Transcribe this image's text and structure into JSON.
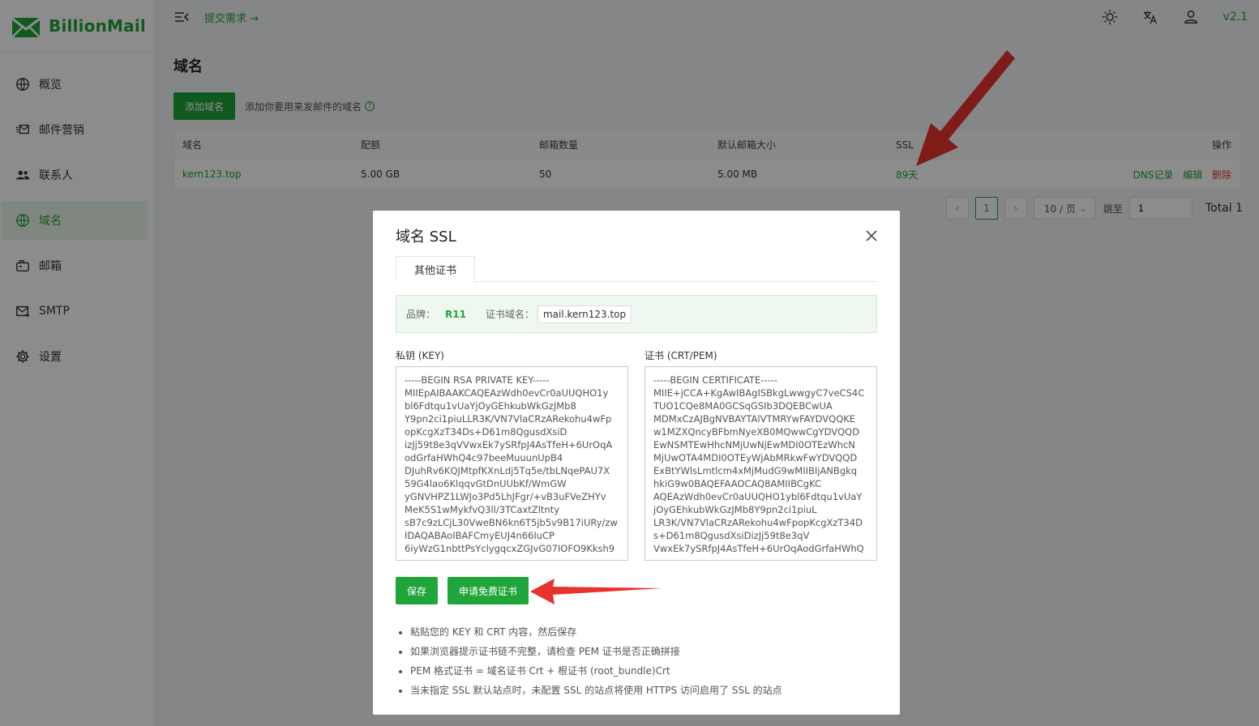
{
  "app": {
    "name": "BillionMail",
    "version": "v2.1"
  },
  "header": {
    "submit_label": "提交需求 →"
  },
  "sidebar": {
    "items": [
      {
        "label": "概览",
        "icon": "globe-icon"
      },
      {
        "label": "邮件营销",
        "icon": "mail-campaign-icon"
      },
      {
        "label": "联系人",
        "icon": "contacts-icon"
      },
      {
        "label": "域名",
        "icon": "globe-icon",
        "active": true
      },
      {
        "label": "邮箱",
        "icon": "mailbox-icon"
      },
      {
        "label": "SMTP",
        "icon": "smtp-icon"
      },
      {
        "label": "设置",
        "icon": "gear-icon"
      }
    ]
  },
  "main": {
    "title": "域名",
    "add_button": "添加域名",
    "hint": "添加你要用来发邮件的域名",
    "table": {
      "columns": [
        "域名",
        "配额",
        "邮箱数量",
        "默认邮箱大小",
        "SSL",
        "操作"
      ],
      "rows": [
        {
          "domain": "kern123.top",
          "quota": "5.00 GB",
          "mailboxes": "50",
          "default_size": "5.00 MB",
          "ssl": "89天",
          "ops": [
            "DNS记录",
            "编辑",
            "删除"
          ]
        }
      ]
    },
    "pager": {
      "current": "1",
      "page_size": "10 / 页",
      "goto_label": "跳至",
      "goto_value": "1",
      "total": "Total 1"
    }
  },
  "modal": {
    "title": "域名 SSL",
    "tab": "其他证书",
    "brand_label": "品牌：",
    "brand_value": "R11",
    "cert_domain_label": "证书域名：",
    "cert_domain_value": "mail.kern123.top",
    "key_label": "私钥 (KEY)",
    "cert_label": "证书 (CRT/PEM)",
    "key_value": "-----BEGIN RSA PRIVATE KEY-----\nMIIEpAIBAAKCAQEAzWdh0evCr0aUUQHO1y\nbl6Fdtqu1vUaYjOyGEhkubWkGzJMb8\nY9pn2ci1piuLLR3K/VN7VlaCRzARekohu4wFp\nopKcgXzT34Ds+D61m8QgusdXsiD\nizJj59t8e3qVVwxEk7ySRfpJ4AsTfeH+6UrOqA\nodGrfaHWhQ4c97beeMuuunUpB4\nDJuhRv6KQJMtpfKXnLdj5Tq5e/tbLNqePAU7X\n59G4lao6KlqqvGtDnUUbKf/WmGW\nyGNVHPZ1LWJo3Pd5LhJFgr/+vB3uFVeZHYv\nMeK5S1wMykfvQ3ll/3TCaxtZltnty\nsB7c9zLCjL30VweBN6kn6T5jb5v9B17iURy/zw\nIDAQABAoIBAFCmyEUJ4n66IuCP\n6iyWzG1nbttPsYclygqcxZGJvG07IOFO9Kksh9",
    "cert_value": "-----BEGIN CERTIFICATE-----\nMIIE+jCCA+KgAwIBAgISBkgLwwgyC7veCS4C\nTUO1CQe8MA0GCSqGSIb3DQEBCwUA\nMDMxCzAJBgNVBAYTAlVTMRYwFAYDVQQKE\nw1MZXQncyBFbmNyeXB0MQwwCgYDVQQD\nEwNSMTEwHhcNMjUwNjEwMDI0OTEzWhcN\nMjUwOTA4MDI0OTEyWjAbMRkwFwYDVQQD\nExBtYWlsLmtlcm4xMjMudG9wMIIBIjANBgkq\nhkiG9w0BAQEFAAOCAQ8AMIIBCgKC\nAQEAzWdh0evCr0aUUQHO1ybl6Fdtqu1vUaY\njOyGEhkubWkGzJMb8Y9pn2ci1piuL\nLR3K/VN7VlaCRzARekohu4wFpopKcgXzT34D\ns+D61m8QgusdXsiDizJj59t8e3qV\nVwxEk7ySRfpJ4AsTfeH+6UrOqAodGrfaHWhQ",
    "save_button": "保存",
    "free_cert_button": "申请免费证书",
    "notes": [
      "粘贴您的 KEY 和 CRT 内容，然后保存",
      "如果浏览器提示证书链不完整，请检查 PEM 证书是否正确拼接",
      "PEM 格式证书 = 域名证书 Crt + 根证书 (root_bundle)Crt",
      "当未指定 SSL 默认站点时，未配置 SSL 的站点将使用 HTTPS 访问启用了 SSL 的站点"
    ]
  },
  "colors": {
    "accent": "#20a53a",
    "danger": "#e0412b",
    "arrow": "#e8322c"
  }
}
